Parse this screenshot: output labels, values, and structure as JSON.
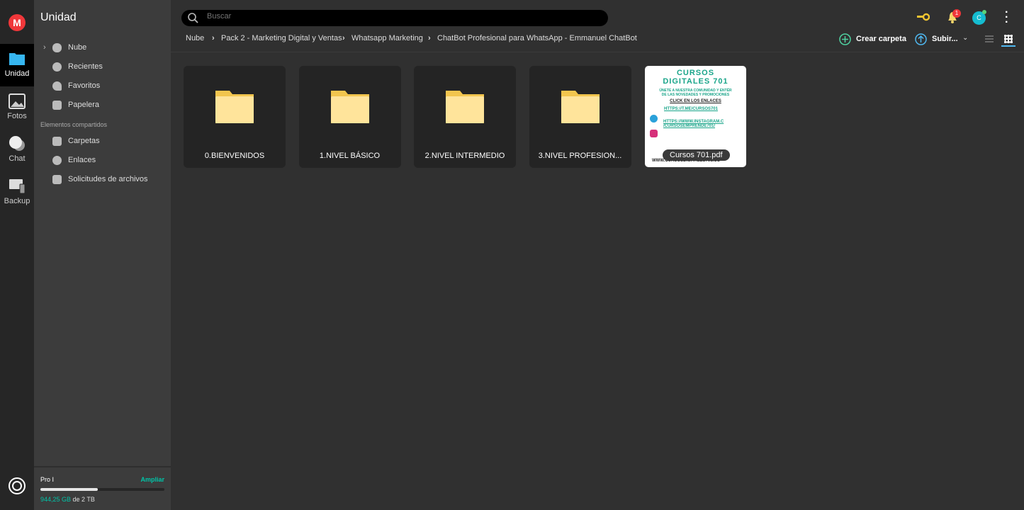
{
  "app": {
    "logo": "M"
  },
  "rail": [
    {
      "label": "Unidad",
      "icon": "folder-icon"
    },
    {
      "label": "Fotos",
      "icon": "photos-icon"
    },
    {
      "label": "Chat",
      "icon": "chat-icon"
    },
    {
      "label": "Backup",
      "icon": "backup-icon"
    }
  ],
  "sidebar": {
    "title": "Unidad",
    "items": [
      {
        "label": "Nube",
        "icon": "cloud-icon"
      },
      {
        "label": "Recientes",
        "icon": "clock-icon"
      },
      {
        "label": "Favoritos",
        "icon": "heart-icon"
      },
      {
        "label": "Papelera",
        "icon": "trash-icon"
      }
    ],
    "shared_title": "Elementos compartidos",
    "shared": [
      {
        "label": "Carpetas",
        "icon": "shared-folder-icon"
      },
      {
        "label": "Enlaces",
        "icon": "link-icon"
      },
      {
        "label": "Solicitudes de archivos",
        "icon": "file-request-icon"
      }
    ]
  },
  "storage": {
    "plan": "Pro I",
    "upgrade": "Ampliar",
    "used": "944,25 GB",
    "of": "de 2 TB",
    "used_fraction": 0.46
  },
  "search": {
    "placeholder": "Buscar"
  },
  "header": {
    "notifications": "1",
    "avatar": "C"
  },
  "breadcrumb": [
    "Nube",
    "Pack 2 - Marketing Digital y Ventas",
    "Whatsapp Marketing",
    "ChatBot Profesional para WhatsApp - Emmanuel ChatBot"
  ],
  "toolbar": {
    "create": "Crear carpeta",
    "upload": "Subir..."
  },
  "files": [
    {
      "name": "0.BIENVENIDOS"
    },
    {
      "name": "1.NIVEL BÁSICO"
    },
    {
      "name": "2.NIVEL INTERMEDIO"
    },
    {
      "name": "3.NIVEL PROFESION..."
    }
  ],
  "pdf": {
    "name": "Cursos 701.pdf",
    "thumb": {
      "title1": "CURSOS",
      "title2": "DIGITALES 701",
      "line1": "ÚNETE A NUESTRA COMUNIDAD Y ENTÉR",
      "line2": "DE LAS NOVEDADES Y PROMOCIONES",
      "click": "CLICK EN LOS ENLACES",
      "link1": "HTTPS://T.ME/CURSOS701",
      "link2a": "HTTPS://WWW.INSTAGRAM.C",
      "link2b": "/CURSOSEMPRENDE701/",
      "web": "WWW.CURSOSDIGITALES701.CO"
    }
  },
  "colors": {
    "accent": "#00c4a8",
    "brand": "#f0373a",
    "folder": "#ffe49b"
  }
}
